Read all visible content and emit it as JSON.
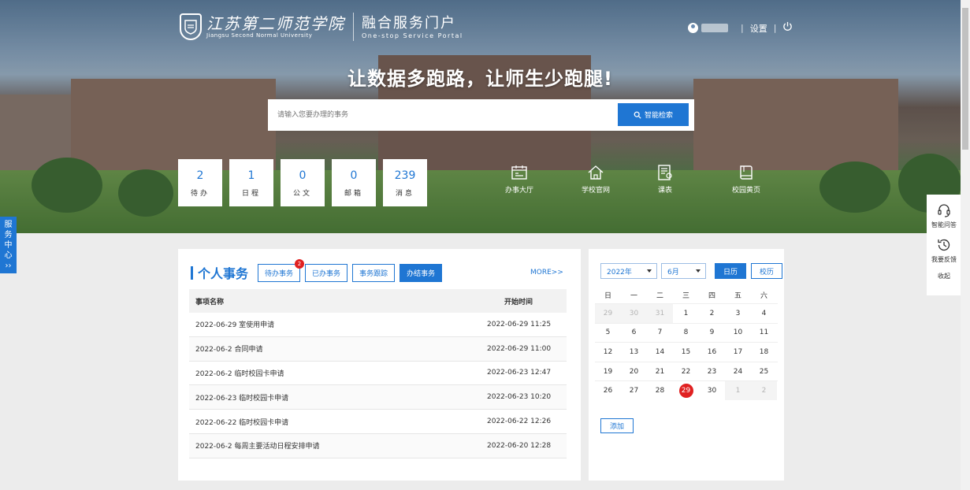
{
  "header": {
    "school_cn": "江苏第二师范学院",
    "school_en": "Jiangsu Second Normal University",
    "portal_title": "融合服务门户",
    "portal_en": "One-stop Service Portal",
    "settings_label": "设置",
    "separator": "|"
  },
  "hero": {
    "slogan": "让数据多跑路，让师生少跑腿!",
    "search_placeholder": "请输入您要办理的事务",
    "search_button": "智能检索"
  },
  "stats": [
    {
      "num": "2",
      "label": "待办"
    },
    {
      "num": "1",
      "label": "日程"
    },
    {
      "num": "0",
      "label": "公文"
    },
    {
      "num": "0",
      "label": "邮箱"
    },
    {
      "num": "239",
      "label": "消息"
    }
  ],
  "quick_links": [
    {
      "label": "办事大厅",
      "icon": "service-hall-icon"
    },
    {
      "label": "学校官网",
      "icon": "home-icon"
    },
    {
      "label": "课表",
      "icon": "timetable-icon"
    },
    {
      "label": "校园黄页",
      "icon": "book-icon"
    }
  ],
  "side_tab": [
    "服",
    "务",
    "中",
    "心",
    "››"
  ],
  "side_right": {
    "qa_label": "智能问答",
    "feedback_label": "我要反馈",
    "collapse_label": "收起"
  },
  "affairs": {
    "title": "个人事务",
    "tabs": [
      {
        "label": "待办事务",
        "badge": "2"
      },
      {
        "label": "已办事务"
      },
      {
        "label": "事务跟踪"
      },
      {
        "label": "办结事务"
      }
    ],
    "more": "MORE>>",
    "columns": [
      "事项名称",
      "开始时间"
    ],
    "rows": [
      {
        "name": "2022-06-29 室使用申请",
        "time": "2022-06-29 11:25"
      },
      {
        "name": "2022-06-2 合同申请",
        "time": "2022-06-29 11:00"
      },
      {
        "name": "2022-06-2 临时校园卡申请",
        "time": "2022-06-23 12:47"
      },
      {
        "name": "2022-06-23 临时校园卡申请",
        "time": "2022-06-23 10:20"
      },
      {
        "name": "2022-06-22 临时校园卡申请",
        "time": "2022-06-22 12:26"
      },
      {
        "name": "2022-06-2 每周主要活动日程安排申请",
        "time": "2022-06-20 12:28"
      }
    ]
  },
  "calendar": {
    "year": "2022年",
    "month": "6月",
    "view_calendar": "日历",
    "view_school": "校历",
    "weekdays": [
      "日",
      "一",
      "二",
      "三",
      "四",
      "五",
      "六"
    ],
    "weeks": [
      [
        "29",
        "30",
        "31",
        "1",
        "2",
        "3",
        "4"
      ],
      [
        "5",
        "6",
        "7",
        "8",
        "9",
        "10",
        "11"
      ],
      [
        "12",
        "13",
        "14",
        "15",
        "16",
        "17",
        "18"
      ],
      [
        "19",
        "20",
        "21",
        "22",
        "23",
        "24",
        "25"
      ],
      [
        "26",
        "27",
        "28",
        "29",
        "30",
        "1",
        "2"
      ]
    ],
    "today": "29",
    "add_label": "添加"
  },
  "colors": {
    "accent": "#1f76d3",
    "badge": "#e02020"
  }
}
